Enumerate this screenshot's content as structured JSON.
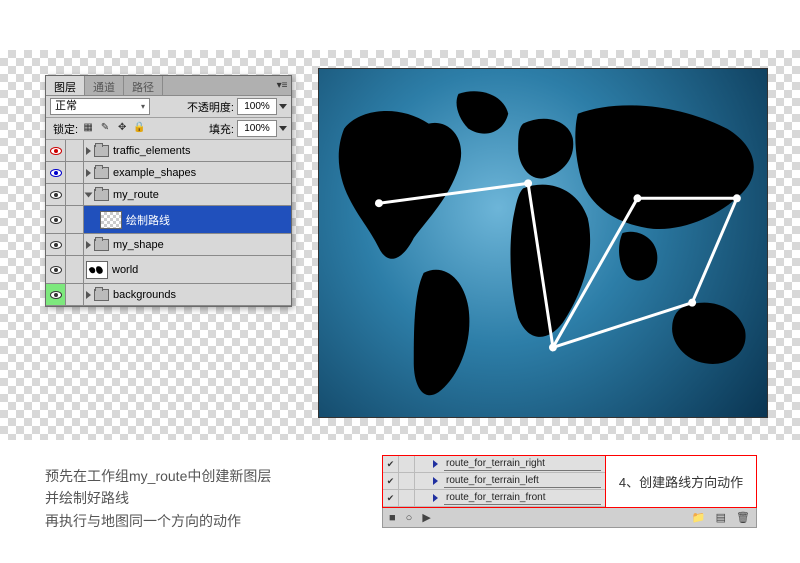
{
  "panel": {
    "tabs": {
      "layers": "图层",
      "channels": "通道",
      "paths": "路径"
    },
    "blend_mode": "正常",
    "opacity_label": "不透明度:",
    "opacity_value": "100%",
    "lock_label": "锁定:",
    "fill_label": "填充:",
    "fill_value": "100%"
  },
  "layers": [
    {
      "name": "traffic_elements",
      "type": "group",
      "vis": "red"
    },
    {
      "name": "example_shapes",
      "type": "group",
      "vis": "blue"
    },
    {
      "name": "my_route",
      "type": "group",
      "vis": "norm",
      "open": true
    },
    {
      "name": "绘制路线",
      "type": "layer",
      "vis": "norm",
      "selected": true,
      "indent": 1
    },
    {
      "name": "my_shape",
      "type": "group",
      "vis": "norm"
    },
    {
      "name": "world",
      "type": "layer",
      "vis": "norm",
      "world": true
    },
    {
      "name": "backgrounds",
      "type": "group",
      "vis": "green"
    }
  ],
  "instructions": {
    "l1": "预先在工作组my_route中创建新图层",
    "l2": "并绘制好路线",
    "l3": "再执行与地图同一个方向的动作"
  },
  "actions": {
    "items": [
      "route_for_terrain_right",
      "route_for_terrain_left",
      "route_for_terrain_front"
    ],
    "callout": "4、创建路线方向动作"
  }
}
